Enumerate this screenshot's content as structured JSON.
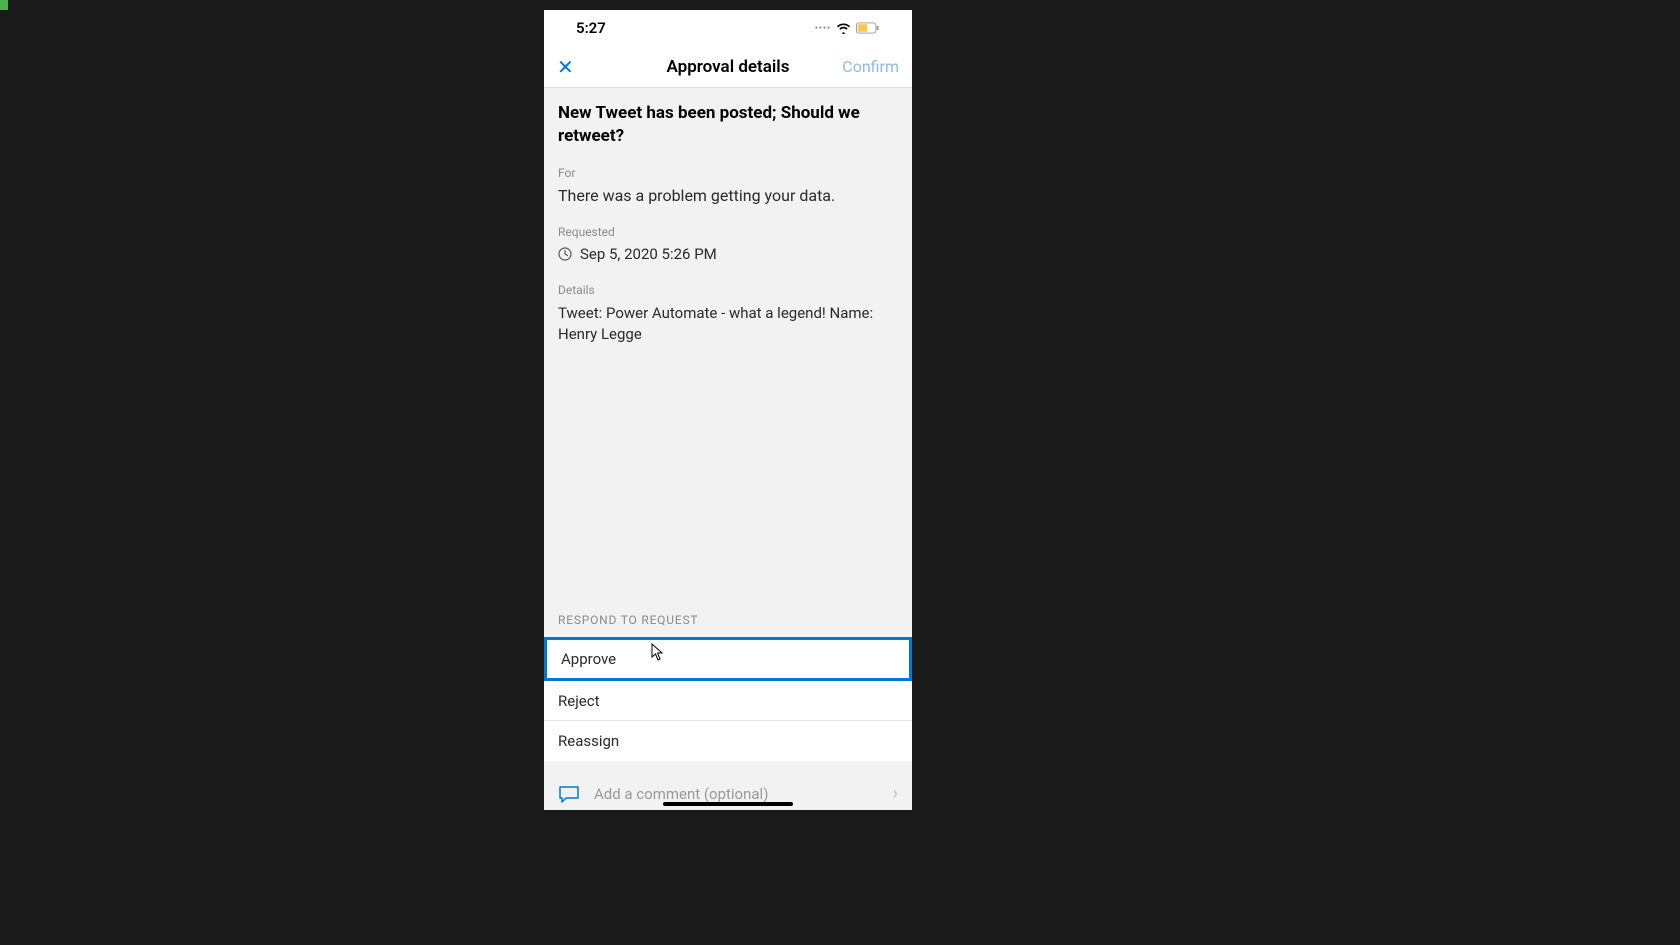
{
  "status": {
    "time": "5:27"
  },
  "nav": {
    "title": "Approval details",
    "confirm": "Confirm"
  },
  "approval": {
    "title": "New Tweet has been posted; Should we retweet?",
    "for_label": "For",
    "for_value": "There was a problem getting your data.",
    "requested_label": "Requested",
    "requested_value": "Sep 5, 2020 5:26 PM",
    "details_label": "Details",
    "details_value": "Tweet: Power Automate - what a legend! Name: Henry Legge"
  },
  "respond": {
    "label": "RESPOND TO REQUEST",
    "options": {
      "approve": "Approve",
      "reject": "Reject",
      "reassign": "Reassign"
    }
  },
  "comment": {
    "placeholder": "Add a comment (optional)"
  }
}
